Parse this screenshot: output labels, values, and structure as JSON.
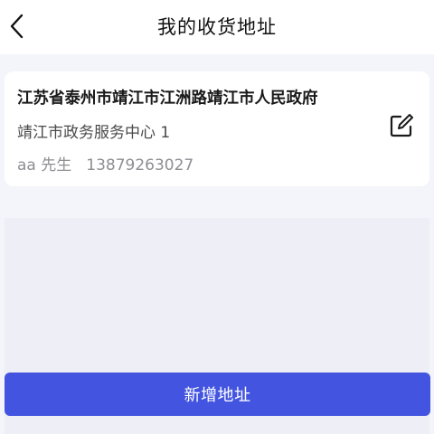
{
  "header": {
    "back_icon": "chevron-left-icon",
    "title": "我的收货地址"
  },
  "address": {
    "full_address": "江苏省泰州市靖江市江洲路靖江市人民政府",
    "detail": "靖江市政务服务中心 1",
    "name": "aa 先生",
    "phone": "13879263027",
    "edit_icon": "edit-icon"
  },
  "footer": {
    "add_button_label": "新增地址"
  },
  "colors": {
    "accent": "#4355e0",
    "background": "#f4f5fa"
  }
}
